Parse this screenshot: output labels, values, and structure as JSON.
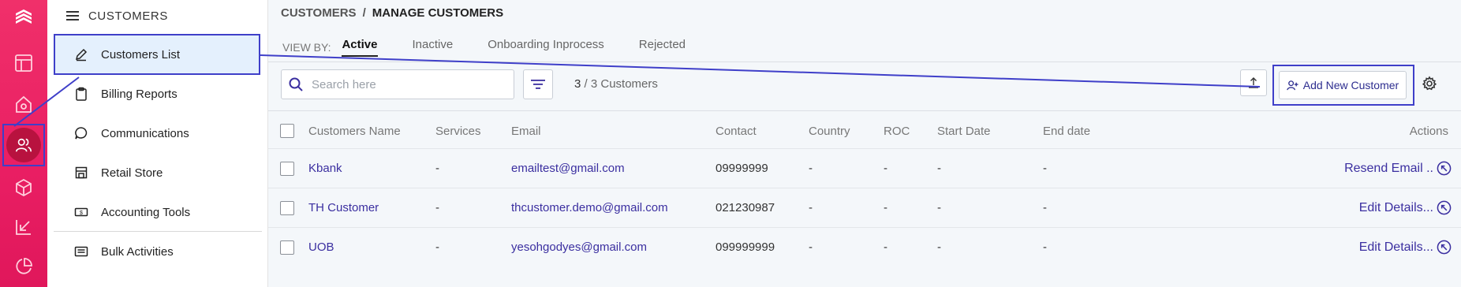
{
  "colors": {
    "rail": "#e91e63",
    "accent": "#3b2fa0",
    "highlight_box": "#3f3fc9",
    "selected_bg": "#e4f0fd"
  },
  "rail": {
    "icons": [
      {
        "name": "logo-icon"
      },
      {
        "name": "layout-icon"
      },
      {
        "name": "home-icon"
      },
      {
        "name": "users-icon",
        "active": true
      },
      {
        "name": "box-icon"
      },
      {
        "name": "arrow-down-left-icon"
      },
      {
        "name": "pie-chart-icon"
      }
    ]
  },
  "sidebar": {
    "title": "CUSTOMERS",
    "items": [
      {
        "label": "Customers List",
        "icon": "pencil-icon",
        "selected": true
      },
      {
        "label": "Billing Reports",
        "icon": "clipboard-icon"
      },
      {
        "label": "Communications",
        "icon": "chat-bubble-icon"
      },
      {
        "label": "Retail Store",
        "icon": "store-icon"
      },
      {
        "label": "Accounting Tools",
        "icon": "money-icon"
      },
      {
        "label": "Bulk Activities",
        "icon": "list-card-icon"
      }
    ]
  },
  "header": {
    "breadcrumb_root": "CUSTOMERS",
    "breadcrumb_sep": "/",
    "breadcrumb_current": "MANAGE CUSTOMERS"
  },
  "view_by": {
    "label": "VIEW BY:",
    "tabs": [
      {
        "label": "Active",
        "active": true
      },
      {
        "label": "Inactive"
      },
      {
        "label": "Onboarding Inprocess"
      },
      {
        "label": "Rejected"
      }
    ]
  },
  "toolbar": {
    "search_placeholder": "Search here",
    "count_shown": "3",
    "count_total": "/ 3 Customers",
    "add_label": "Add New Customer"
  },
  "table": {
    "columns": {
      "name": "Customers Name",
      "services": "Services",
      "email": "Email",
      "contact": "Contact",
      "country": "Country",
      "roc": "ROC",
      "start": "Start Date",
      "end": "End date",
      "actions": "Actions"
    },
    "rows": [
      {
        "name": "Kbank",
        "services": "-",
        "email": "emailtest@gmail.com",
        "contact": "09999999",
        "country": "-",
        "roc": "-",
        "start": "-",
        "end": "-",
        "action": "Resend Email .."
      },
      {
        "name": "TH Customer",
        "services": "-",
        "email": "thcustomer.demo@gmail.com",
        "contact": "021230987",
        "country": "-",
        "roc": "-",
        "start": "-",
        "end": "-",
        "action": "Edit Details..."
      },
      {
        "name": "UOB",
        "services": "-",
        "email": "yesohgodyes@gmail.com",
        "contact": "099999999",
        "country": "-",
        "roc": "-",
        "start": "-",
        "end": "-",
        "action": "Edit Details..."
      }
    ]
  }
}
